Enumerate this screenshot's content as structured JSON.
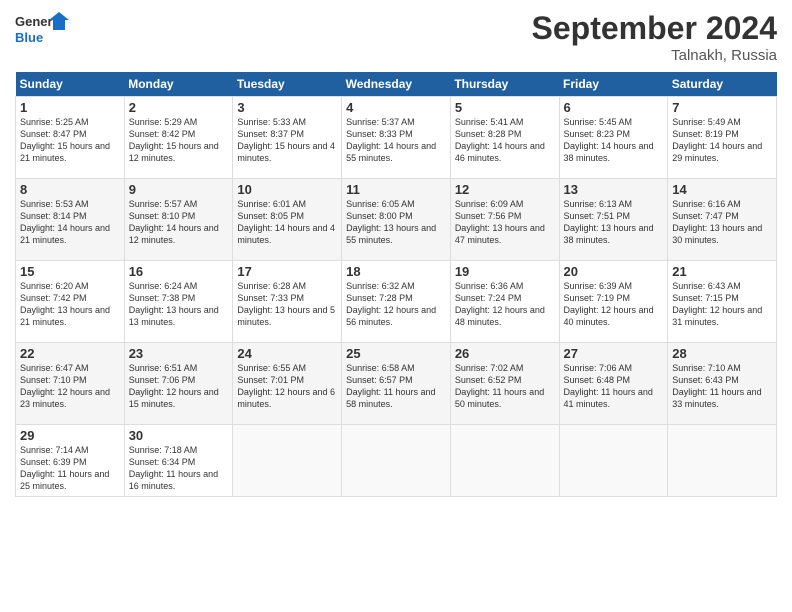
{
  "header": {
    "logo_general": "General",
    "logo_blue": "Blue",
    "month_title": "September 2024",
    "location": "Talnakh, Russia"
  },
  "days_of_week": [
    "Sunday",
    "Monday",
    "Tuesday",
    "Wednesday",
    "Thursday",
    "Friday",
    "Saturday"
  ],
  "weeks": [
    [
      {
        "day": "1",
        "sunrise": "Sunrise: 5:25 AM",
        "sunset": "Sunset: 8:47 PM",
        "daylight": "Daylight: 15 hours and 21 minutes."
      },
      {
        "day": "2",
        "sunrise": "Sunrise: 5:29 AM",
        "sunset": "Sunset: 8:42 PM",
        "daylight": "Daylight: 15 hours and 12 minutes."
      },
      {
        "day": "3",
        "sunrise": "Sunrise: 5:33 AM",
        "sunset": "Sunset: 8:37 PM",
        "daylight": "Daylight: 15 hours and 4 minutes."
      },
      {
        "day": "4",
        "sunrise": "Sunrise: 5:37 AM",
        "sunset": "Sunset: 8:33 PM",
        "daylight": "Daylight: 14 hours and 55 minutes."
      },
      {
        "day": "5",
        "sunrise": "Sunrise: 5:41 AM",
        "sunset": "Sunset: 8:28 PM",
        "daylight": "Daylight: 14 hours and 46 minutes."
      },
      {
        "day": "6",
        "sunrise": "Sunrise: 5:45 AM",
        "sunset": "Sunset: 8:23 PM",
        "daylight": "Daylight: 14 hours and 38 minutes."
      },
      {
        "day": "7",
        "sunrise": "Sunrise: 5:49 AM",
        "sunset": "Sunset: 8:19 PM",
        "daylight": "Daylight: 14 hours and 29 minutes."
      }
    ],
    [
      {
        "day": "8",
        "sunrise": "Sunrise: 5:53 AM",
        "sunset": "Sunset: 8:14 PM",
        "daylight": "Daylight: 14 hours and 21 minutes."
      },
      {
        "day": "9",
        "sunrise": "Sunrise: 5:57 AM",
        "sunset": "Sunset: 8:10 PM",
        "daylight": "Daylight: 14 hours and 12 minutes."
      },
      {
        "day": "10",
        "sunrise": "Sunrise: 6:01 AM",
        "sunset": "Sunset: 8:05 PM",
        "daylight": "Daylight: 14 hours and 4 minutes."
      },
      {
        "day": "11",
        "sunrise": "Sunrise: 6:05 AM",
        "sunset": "Sunset: 8:00 PM",
        "daylight": "Daylight: 13 hours and 55 minutes."
      },
      {
        "day": "12",
        "sunrise": "Sunrise: 6:09 AM",
        "sunset": "Sunset: 7:56 PM",
        "daylight": "Daylight: 13 hours and 47 minutes."
      },
      {
        "day": "13",
        "sunrise": "Sunrise: 6:13 AM",
        "sunset": "Sunset: 7:51 PM",
        "daylight": "Daylight: 13 hours and 38 minutes."
      },
      {
        "day": "14",
        "sunrise": "Sunrise: 6:16 AM",
        "sunset": "Sunset: 7:47 PM",
        "daylight": "Daylight: 13 hours and 30 minutes."
      }
    ],
    [
      {
        "day": "15",
        "sunrise": "Sunrise: 6:20 AM",
        "sunset": "Sunset: 7:42 PM",
        "daylight": "Daylight: 13 hours and 21 minutes."
      },
      {
        "day": "16",
        "sunrise": "Sunrise: 6:24 AM",
        "sunset": "Sunset: 7:38 PM",
        "daylight": "Daylight: 13 hours and 13 minutes."
      },
      {
        "day": "17",
        "sunrise": "Sunrise: 6:28 AM",
        "sunset": "Sunset: 7:33 PM",
        "daylight": "Daylight: 13 hours and 5 minutes."
      },
      {
        "day": "18",
        "sunrise": "Sunrise: 6:32 AM",
        "sunset": "Sunset: 7:28 PM",
        "daylight": "Daylight: 12 hours and 56 minutes."
      },
      {
        "day": "19",
        "sunrise": "Sunrise: 6:36 AM",
        "sunset": "Sunset: 7:24 PM",
        "daylight": "Daylight: 12 hours and 48 minutes."
      },
      {
        "day": "20",
        "sunrise": "Sunrise: 6:39 AM",
        "sunset": "Sunset: 7:19 PM",
        "daylight": "Daylight: 12 hours and 40 minutes."
      },
      {
        "day": "21",
        "sunrise": "Sunrise: 6:43 AM",
        "sunset": "Sunset: 7:15 PM",
        "daylight": "Daylight: 12 hours and 31 minutes."
      }
    ],
    [
      {
        "day": "22",
        "sunrise": "Sunrise: 6:47 AM",
        "sunset": "Sunset: 7:10 PM",
        "daylight": "Daylight: 12 hours and 23 minutes."
      },
      {
        "day": "23",
        "sunrise": "Sunrise: 6:51 AM",
        "sunset": "Sunset: 7:06 PM",
        "daylight": "Daylight: 12 hours and 15 minutes."
      },
      {
        "day": "24",
        "sunrise": "Sunrise: 6:55 AM",
        "sunset": "Sunset: 7:01 PM",
        "daylight": "Daylight: 12 hours and 6 minutes."
      },
      {
        "day": "25",
        "sunrise": "Sunrise: 6:58 AM",
        "sunset": "Sunset: 6:57 PM",
        "daylight": "Daylight: 11 hours and 58 minutes."
      },
      {
        "day": "26",
        "sunrise": "Sunrise: 7:02 AM",
        "sunset": "Sunset: 6:52 PM",
        "daylight": "Daylight: 11 hours and 50 minutes."
      },
      {
        "day": "27",
        "sunrise": "Sunrise: 7:06 AM",
        "sunset": "Sunset: 6:48 PM",
        "daylight": "Daylight: 11 hours and 41 minutes."
      },
      {
        "day": "28",
        "sunrise": "Sunrise: 7:10 AM",
        "sunset": "Sunset: 6:43 PM",
        "daylight": "Daylight: 11 hours and 33 minutes."
      }
    ],
    [
      {
        "day": "29",
        "sunrise": "Sunrise: 7:14 AM",
        "sunset": "Sunset: 6:39 PM",
        "daylight": "Daylight: 11 hours and 25 minutes."
      },
      {
        "day": "30",
        "sunrise": "Sunrise: 7:18 AM",
        "sunset": "Sunset: 6:34 PM",
        "daylight": "Daylight: 11 hours and 16 minutes."
      },
      null,
      null,
      null,
      null,
      null
    ]
  ]
}
